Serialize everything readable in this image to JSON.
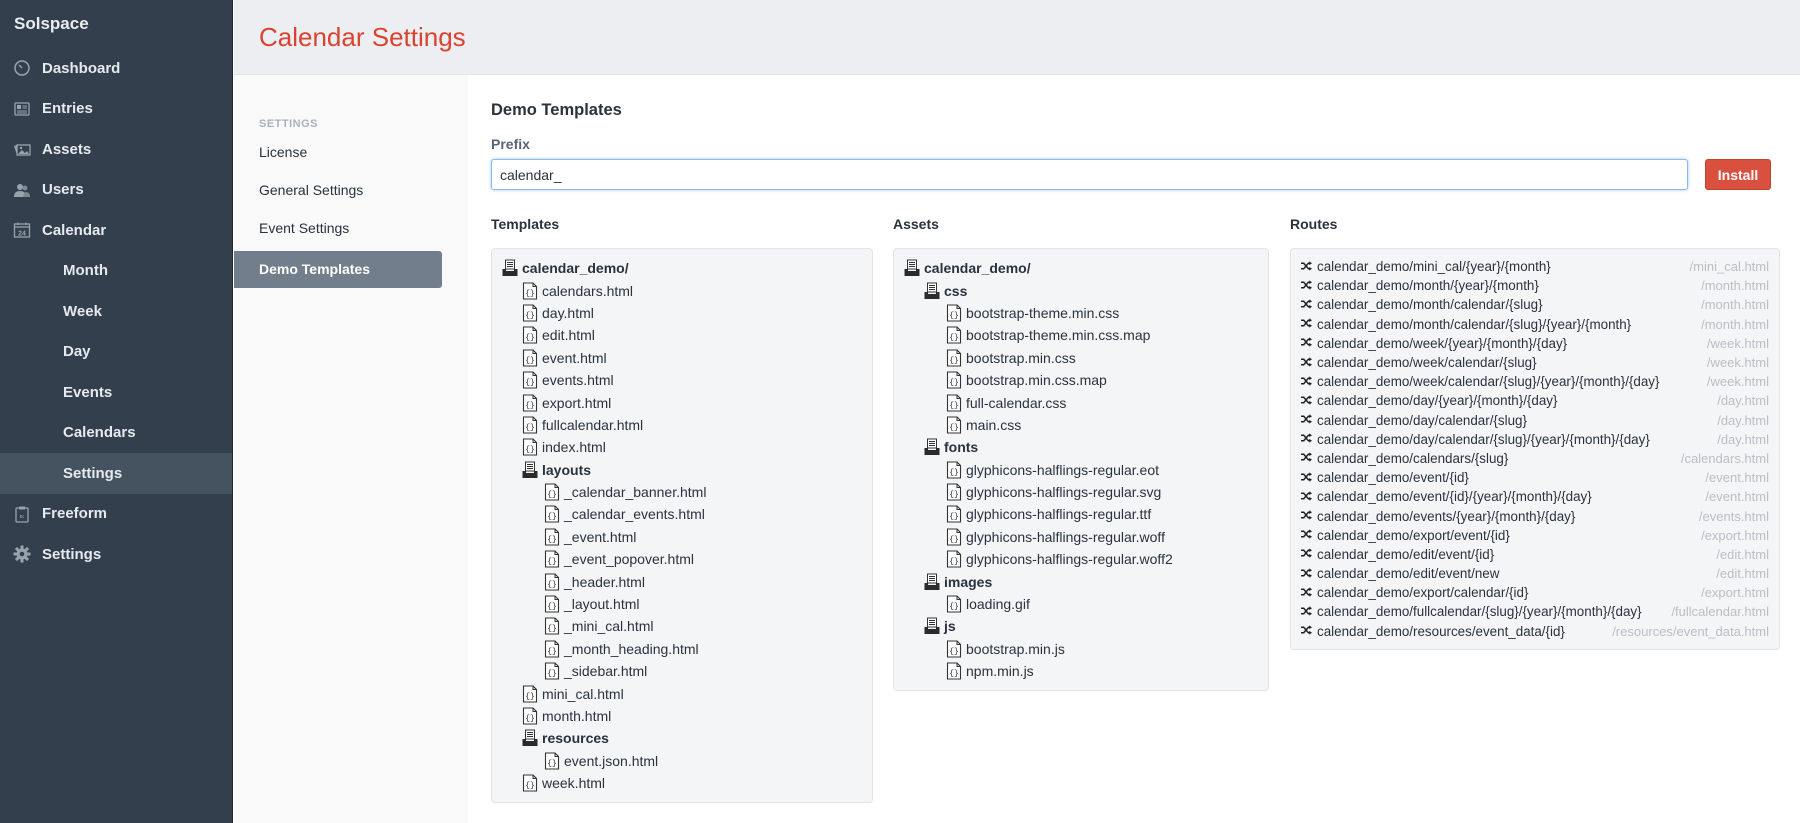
{
  "brand": "Solspace",
  "nav": [
    {
      "label": "Dashboard",
      "icon": "dashboard-icon"
    },
    {
      "label": "Entries",
      "icon": "entries-icon"
    },
    {
      "label": "Assets",
      "icon": "assets-icon"
    },
    {
      "label": "Users",
      "icon": "users-icon"
    },
    {
      "label": "Calendar",
      "icon": "calendar-icon"
    },
    {
      "label": "Month",
      "sub": true
    },
    {
      "label": "Week",
      "sub": true
    },
    {
      "label": "Day",
      "sub": true
    },
    {
      "label": "Events",
      "sub": true
    },
    {
      "label": "Calendars",
      "sub": true
    },
    {
      "label": "Settings",
      "sub": true,
      "active": true
    },
    {
      "label": "Freeform",
      "icon": "freeform-icon"
    },
    {
      "label": "Settings",
      "icon": "gear-icon"
    }
  ],
  "header": {
    "title": "Calendar Settings"
  },
  "settings_nav": {
    "heading": "SETTINGS",
    "items": [
      {
        "label": "License"
      },
      {
        "label": "General Settings"
      },
      {
        "label": "Event Settings"
      },
      {
        "label": "Demo Templates",
        "active": true
      }
    ]
  },
  "main": {
    "title": "Demo Templates",
    "prefix_label": "Prefix",
    "prefix_value": "calendar_",
    "install_label": "Install",
    "templates_title": "Templates",
    "assets_title": "Assets",
    "routes_title": "Routes"
  },
  "templates": [
    {
      "name": "calendar_demo/",
      "type": "folder",
      "level": 0
    },
    {
      "name": "calendars.html",
      "type": "file",
      "level": 1
    },
    {
      "name": "day.html",
      "type": "file",
      "level": 1
    },
    {
      "name": "edit.html",
      "type": "file",
      "level": 1
    },
    {
      "name": "event.html",
      "type": "file",
      "level": 1
    },
    {
      "name": "events.html",
      "type": "file",
      "level": 1
    },
    {
      "name": "export.html",
      "type": "file",
      "level": 1
    },
    {
      "name": "fullcalendar.html",
      "type": "file",
      "level": 1
    },
    {
      "name": "index.html",
      "type": "file",
      "level": 1
    },
    {
      "name": "layouts",
      "type": "folder",
      "level": 1
    },
    {
      "name": "_calendar_banner.html",
      "type": "file",
      "level": 2
    },
    {
      "name": "_calendar_events.html",
      "type": "file",
      "level": 2
    },
    {
      "name": "_event.html",
      "type": "file",
      "level": 2
    },
    {
      "name": "_event_popover.html",
      "type": "file",
      "level": 2
    },
    {
      "name": "_header.html",
      "type": "file",
      "level": 2
    },
    {
      "name": "_layout.html",
      "type": "file",
      "level": 2
    },
    {
      "name": "_mini_cal.html",
      "type": "file",
      "level": 2
    },
    {
      "name": "_month_heading.html",
      "type": "file",
      "level": 2
    },
    {
      "name": "_sidebar.html",
      "type": "file",
      "level": 2
    },
    {
      "name": "mini_cal.html",
      "type": "file",
      "level": 1
    },
    {
      "name": "month.html",
      "type": "file",
      "level": 1
    },
    {
      "name": "resources",
      "type": "folder",
      "level": 1
    },
    {
      "name": "event.json.html",
      "type": "file",
      "level": 2
    },
    {
      "name": "week.html",
      "type": "file",
      "level": 1
    }
  ],
  "assets": [
    {
      "name": "calendar_demo/",
      "type": "folder",
      "level": 0
    },
    {
      "name": "css",
      "type": "folder",
      "level": 1
    },
    {
      "name": "bootstrap-theme.min.css",
      "type": "file",
      "level": 2
    },
    {
      "name": "bootstrap-theme.min.css.map",
      "type": "file",
      "level": 2
    },
    {
      "name": "bootstrap.min.css",
      "type": "file",
      "level": 2
    },
    {
      "name": "bootstrap.min.css.map",
      "type": "file",
      "level": 2
    },
    {
      "name": "full-calendar.css",
      "type": "file",
      "level": 2
    },
    {
      "name": "main.css",
      "type": "file",
      "level": 2
    },
    {
      "name": "fonts",
      "type": "folder",
      "level": 1
    },
    {
      "name": "glyphicons-halflings-regular.eot",
      "type": "file",
      "level": 2
    },
    {
      "name": "glyphicons-halflings-regular.svg",
      "type": "file",
      "level": 2
    },
    {
      "name": "glyphicons-halflings-regular.ttf",
      "type": "file",
      "level": 2
    },
    {
      "name": "glyphicons-halflings-regular.woff",
      "type": "file",
      "level": 2
    },
    {
      "name": "glyphicons-halflings-regular.woff2",
      "type": "file",
      "level": 2
    },
    {
      "name": "images",
      "type": "folder",
      "level": 1
    },
    {
      "name": "loading.gif",
      "type": "file",
      "level": 2
    },
    {
      "name": "js",
      "type": "folder",
      "level": 1
    },
    {
      "name": "bootstrap.min.js",
      "type": "file",
      "level": 2
    },
    {
      "name": "npm.min.js",
      "type": "file",
      "level": 2
    }
  ],
  "routes": [
    {
      "path": "calendar_demo/mini_cal/{year}/{month}",
      "template": "/mini_cal.html"
    },
    {
      "path": "calendar_demo/month/{year}/{month}",
      "template": "/month.html"
    },
    {
      "path": "calendar_demo/month/calendar/{slug}",
      "template": "/month.html"
    },
    {
      "path": "calendar_demo/month/calendar/{slug}/{year}/{month}",
      "template": "/month.html"
    },
    {
      "path": "calendar_demo/week/{year}/{month}/{day}",
      "template": "/week.html"
    },
    {
      "path": "calendar_demo/week/calendar/{slug}",
      "template": "/week.html"
    },
    {
      "path": "calendar_demo/week/calendar/{slug}/{year}/{month}/{day}",
      "template": "/week.html"
    },
    {
      "path": "calendar_demo/day/{year}/{month}/{day}",
      "template": "/day.html"
    },
    {
      "path": "calendar_demo/day/calendar/{slug}",
      "template": "/day.html"
    },
    {
      "path": "calendar_demo/day/calendar/{slug}/{year}/{month}/{day}",
      "template": "/day.html"
    },
    {
      "path": "calendar_demo/calendars/{slug}",
      "template": "/calendars.html"
    },
    {
      "path": "calendar_demo/event/{id}",
      "template": "/event.html"
    },
    {
      "path": "calendar_demo/event/{id}/{year}/{month}/{day}",
      "template": "/event.html"
    },
    {
      "path": "calendar_demo/events/{year}/{month}/{day}",
      "template": "/events.html"
    },
    {
      "path": "calendar_demo/export/event/{id}",
      "template": "/export.html"
    },
    {
      "path": "calendar_demo/edit/event/{id}",
      "template": "/edit.html"
    },
    {
      "path": "calendar_demo/edit/event/new",
      "template": "/edit.html"
    },
    {
      "path": "calendar_demo/export/calendar/{id}",
      "template": "/export.html"
    },
    {
      "path": "calendar_demo/fullcalendar/{slug}/{year}/{month}/{day}",
      "template": "/fullcalendar.html"
    },
    {
      "path": "calendar_demo/resources/event_data/{id}",
      "template": "/resources/event_data.html"
    }
  ],
  "colors": {
    "sidebar_bg": "#333f4d",
    "accent_red": "#d9432f",
    "install_button": "#d9503f",
    "active_settings_item": "#727e8b"
  }
}
